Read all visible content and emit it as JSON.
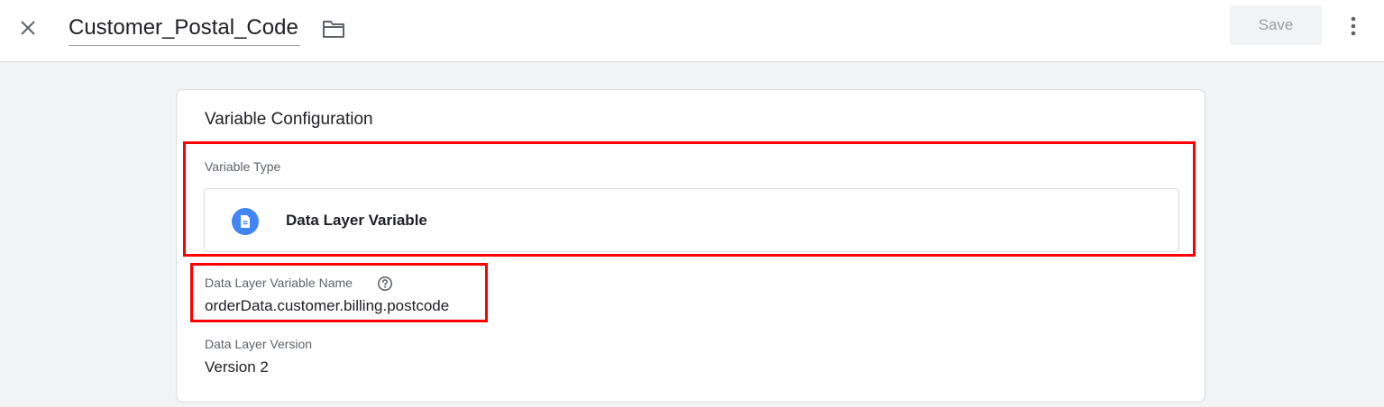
{
  "header": {
    "title": "Customer_Postal_Code",
    "save_label": "Save",
    "close_icon": "close-icon",
    "folder_icon": "folder-icon",
    "more_icon": "more-vert-icon"
  },
  "config": {
    "heading": "Variable Configuration",
    "variable_type_label": "Variable Type",
    "variable_type_name": "Data Layer Variable",
    "variable_type_icon": "document-icon",
    "dlv_name_label": "Data Layer Variable Name",
    "dlv_name_value": "orderData.customer.billing.postcode",
    "help_icon": "help-icon",
    "version_label": "Data Layer Version",
    "version_value": "Version 2"
  },
  "colors": {
    "accent": "#4285f4",
    "highlight": "#ff0000",
    "background": "#f1f3f4"
  }
}
